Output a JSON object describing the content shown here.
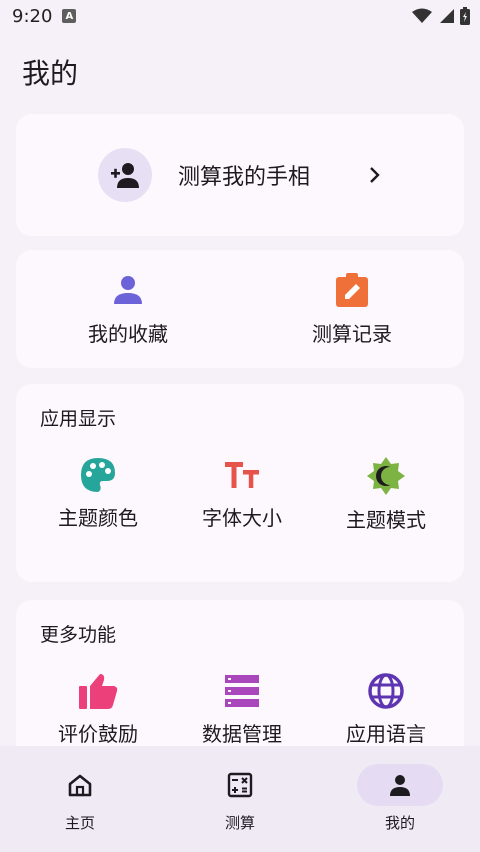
{
  "status_bar": {
    "time": "9:20",
    "badge": "A"
  },
  "page": {
    "title": "我的"
  },
  "measure_card": {
    "label": "测算我的手相"
  },
  "shortcuts": [
    {
      "label": "我的收藏",
      "icon": "person-icon",
      "color": "#6C63D9"
    },
    {
      "label": "测算记录",
      "icon": "clipboard-edit-icon",
      "color": "#F0703A"
    }
  ],
  "display_section": {
    "title": "应用显示",
    "items": [
      {
        "label": "主题颜色",
        "icon": "palette-icon",
        "color": "#26A69A"
      },
      {
        "label": "字体大小",
        "icon": "text-size-icon",
        "color": "#E5534B"
      },
      {
        "label": "主题模式",
        "icon": "brightness-icon",
        "color": "#7CB342"
      }
    ]
  },
  "more_section": {
    "title": "更多功能",
    "items": [
      {
        "label": "评价鼓励",
        "icon": "thumb-up-icon",
        "color": "#EC407A"
      },
      {
        "label": "数据管理",
        "icon": "storage-icon",
        "color": "#AB47BC"
      },
      {
        "label": "应用语言",
        "icon": "globe-icon",
        "color": "#5E35B1"
      }
    ]
  },
  "bottom_nav": [
    {
      "label": "主页",
      "icon": "home-icon",
      "active": false
    },
    {
      "label": "测算",
      "icon": "calculator-icon",
      "active": false
    },
    {
      "label": "我的",
      "icon": "person-icon",
      "active": true
    }
  ]
}
